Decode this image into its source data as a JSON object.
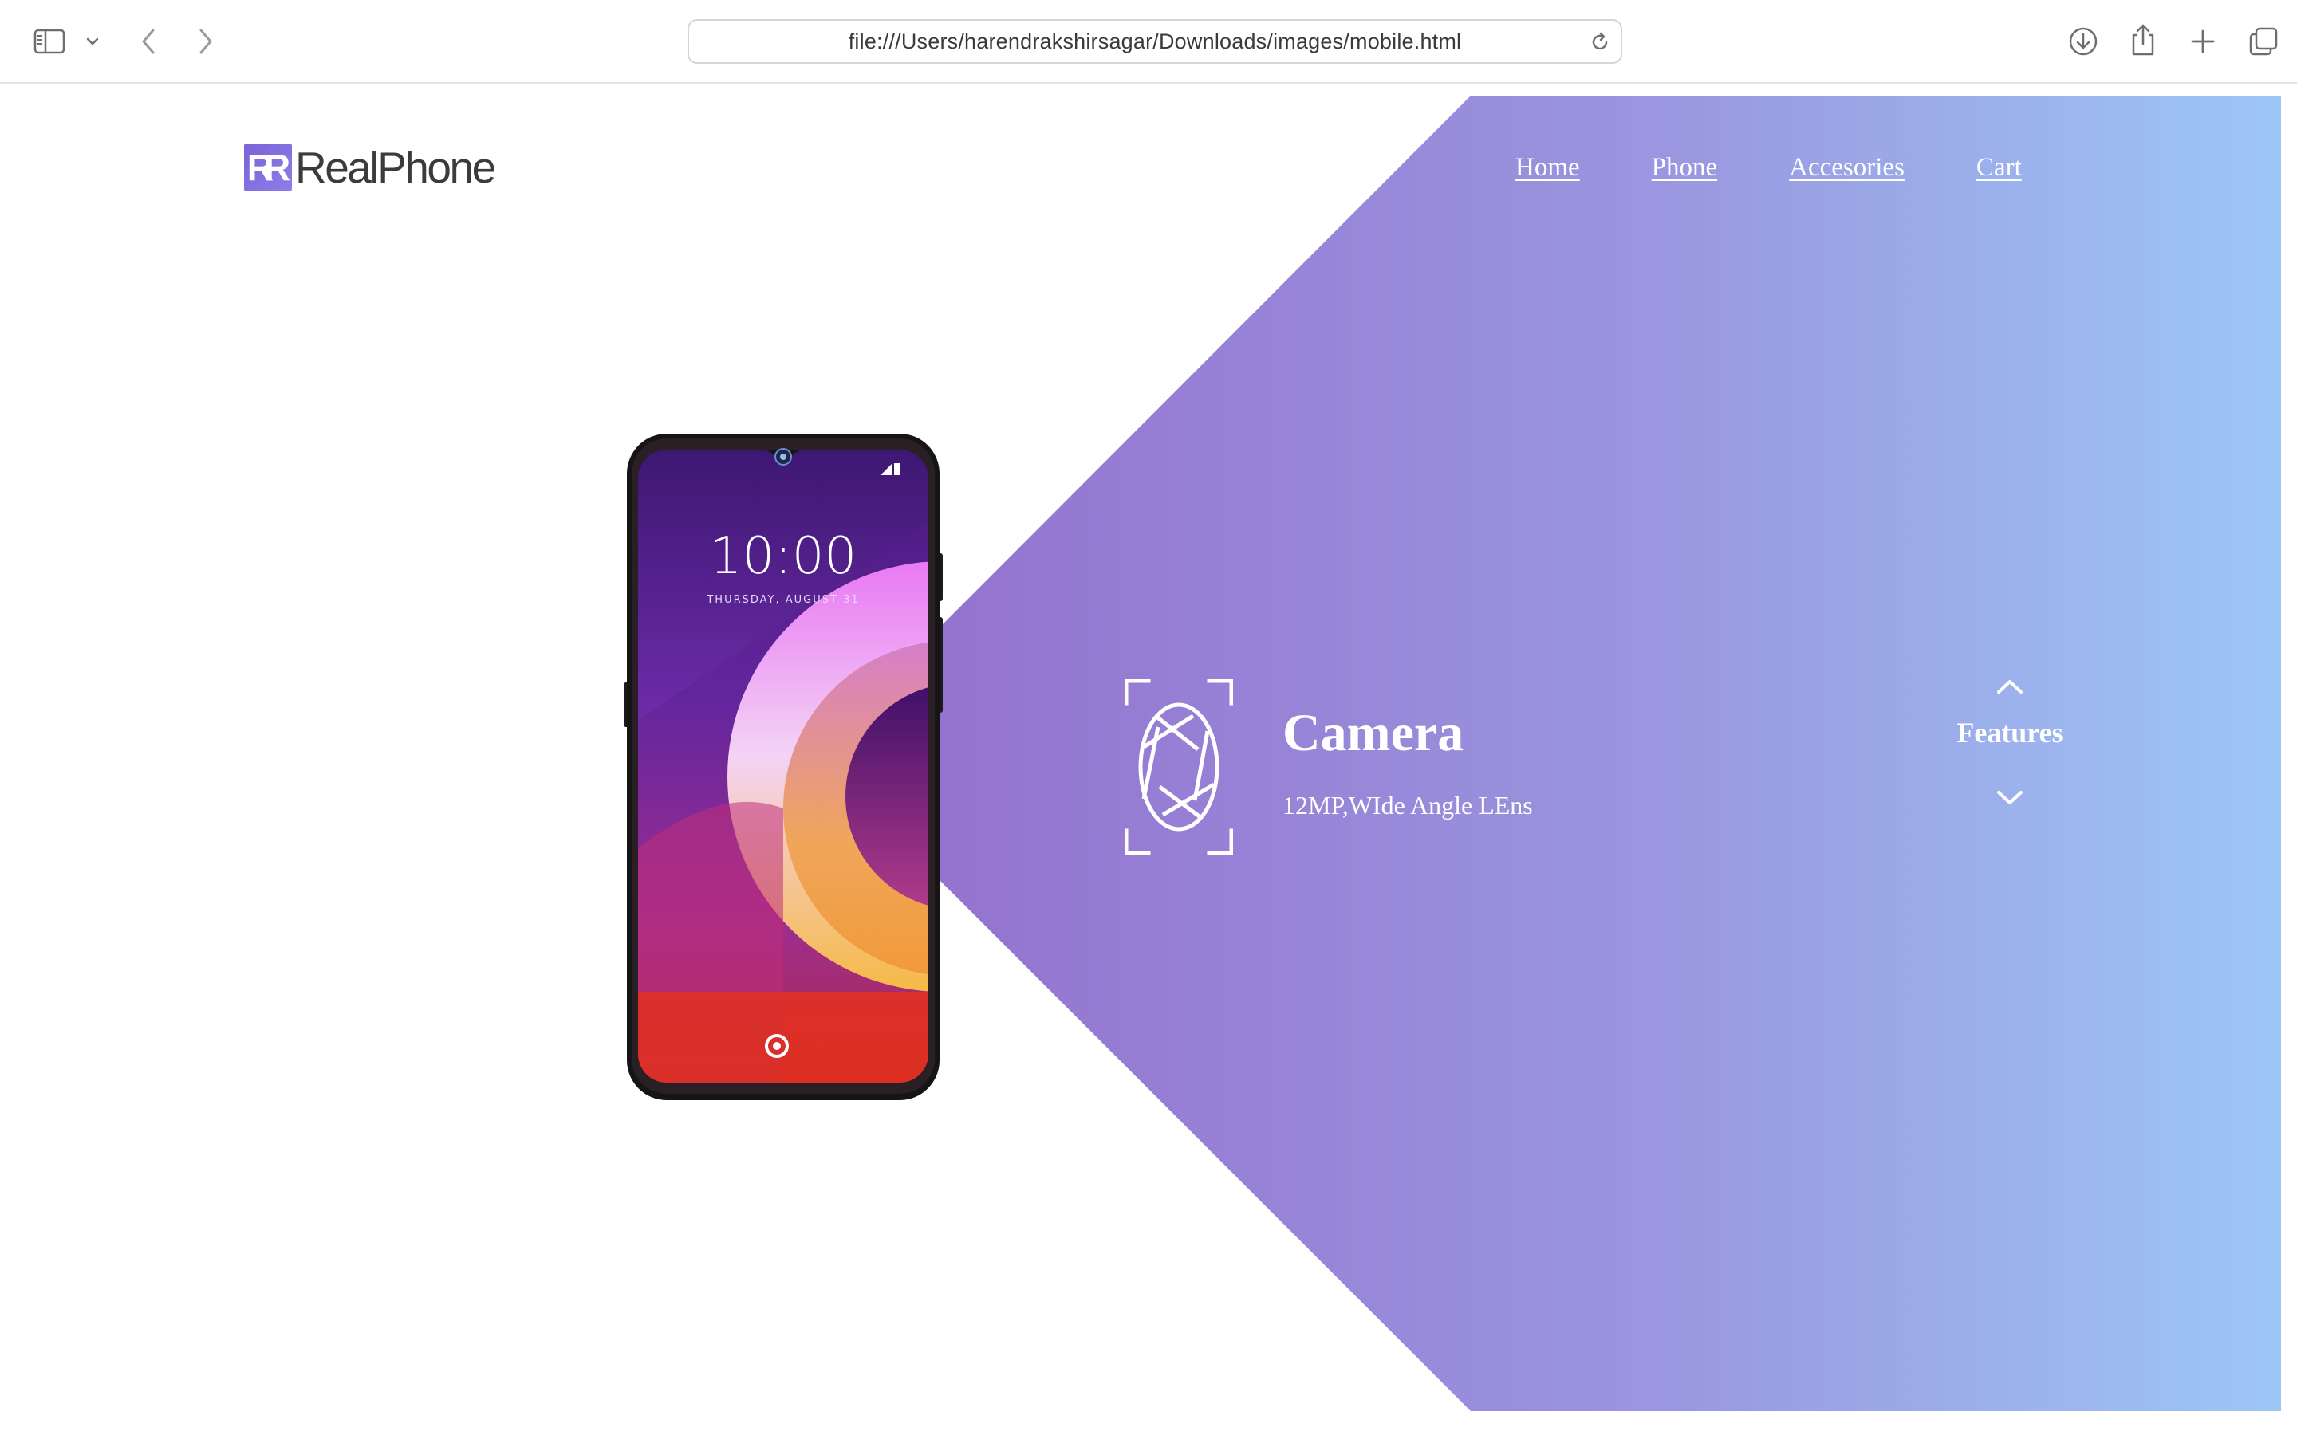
{
  "browser": {
    "url": "file:///Users/harendrakshirsagar/Downloads/images/mobile.html",
    "icons": {
      "sidebar": "sidebar-icon",
      "sidebar_menu": "chevron-down-icon",
      "back": "chevron-left-icon",
      "forward": "chevron-right-icon",
      "reload": "reload-icon",
      "download": "download-icon",
      "share": "share-icon",
      "new_tab": "plus-icon",
      "tabs": "tab-overview-icon"
    }
  },
  "site": {
    "logo_mark": "R",
    "logo_text": "RealPhone",
    "nav": [
      "Home",
      "Phone",
      "Accesories",
      "Cart"
    ]
  },
  "hero": {
    "phone_screen": {
      "time": "10:00",
      "date": "THURSDAY, AUGUST 31"
    },
    "feature": {
      "icon": "camera-aperture-icon",
      "title": "Camera",
      "description": "12MP,WIde Angle LEns"
    },
    "features_nav": {
      "label": "Features",
      "up_icon": "chevron-up-icon",
      "down_icon": "chevron-down-icon"
    }
  },
  "colors": {
    "gradient_start": "#9577d2",
    "gradient_end": "#9ec6f6",
    "logo_mark": "#7b63d6"
  }
}
